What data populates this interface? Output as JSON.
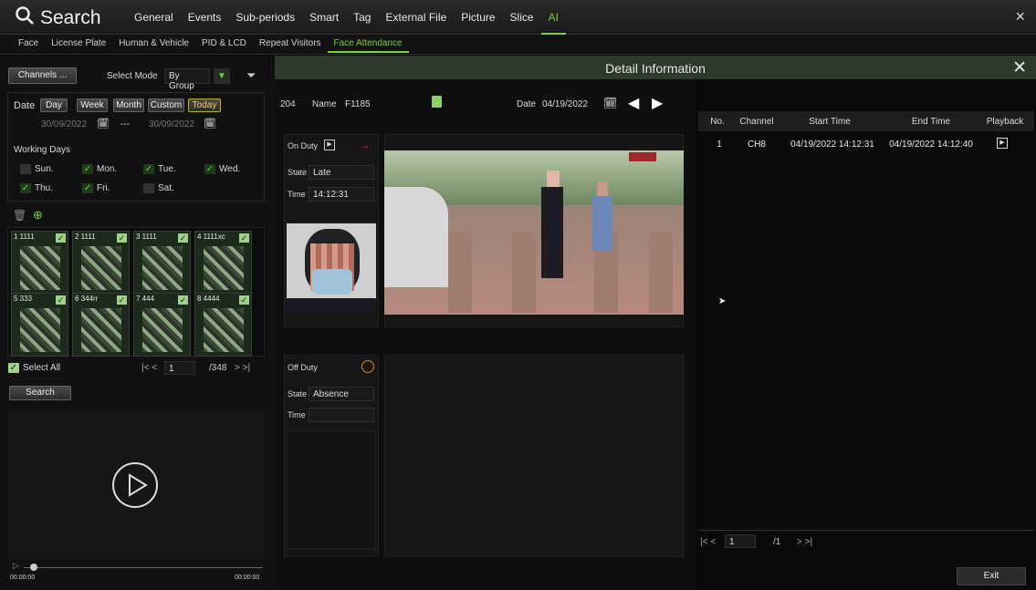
{
  "header": {
    "title": "Search",
    "tabs": [
      "General",
      "Events",
      "Sub-periods",
      "Smart",
      "Tag",
      "External File",
      "Picture",
      "Slice",
      "AI"
    ],
    "active_tab": "AI",
    "close": "×"
  },
  "subtabs": {
    "items": [
      "Face",
      "License Plate",
      "Human & Vehicle",
      "PID & LCD",
      "Repeat Visitors",
      "Face Attendance"
    ],
    "active": "Face Attendance"
  },
  "left": {
    "channels_button": "Channels ...",
    "select_mode_label": "Select Mode",
    "select_mode_value": "By Group",
    "date_label": "Date",
    "date_buttons": [
      "Day",
      "Week",
      "Month",
      "Custom",
      "Today"
    ],
    "date_from": "30/09/2022",
    "date_sep": "---",
    "date_to": "30/09/2022",
    "working_days_label": "Working Days",
    "days": [
      {
        "label": "Sun.",
        "checked": false
      },
      {
        "label": "Mon.",
        "checked": true
      },
      {
        "label": "Tue.",
        "checked": true
      },
      {
        "label": "Wed.",
        "checked": true
      },
      {
        "label": "Thu.",
        "checked": true
      },
      {
        "label": "Fri.",
        "checked": true
      },
      {
        "label": "Sat.",
        "checked": false
      }
    ],
    "faces": [
      "1 1111",
      "2 1111",
      "3 1111",
      "4 1111xc",
      "5 333",
      "6 344rr",
      "7 444",
      "8 4444"
    ],
    "select_all": "Select All",
    "page_current": "1",
    "page_total": "/348",
    "search_button": "Search",
    "time_start": "00:00:00",
    "time_end": "00:00:00"
  },
  "detail": {
    "title": "Detail Information",
    "id": "204",
    "name_label": "Name",
    "name_value": "F1185",
    "date_label": "Date",
    "date_value": "04/19/2022",
    "on_duty": {
      "label": "On Duty",
      "state_label": "State",
      "state_value": "Late",
      "time_label": "Time",
      "time_value": "14:12:31"
    },
    "off_duty": {
      "label": "Off Duty",
      "state_label": "State",
      "state_value": "Absence",
      "time_label": "Time",
      "time_value": ""
    }
  },
  "table": {
    "headers": [
      "No.",
      "Channel",
      "Start Time",
      "End Time",
      "Playback"
    ],
    "rows": [
      {
        "no": "1",
        "channel": "CH8",
        "start": "04/19/2022 14:12:31",
        "end": "04/19/2022 14:12:40"
      }
    ],
    "page_current": "1",
    "page_total": "/1",
    "exit_button": "Exit"
  },
  "colors": {
    "accent": "#7ccf3c",
    "panel": "#111111",
    "header": "#2d3a2b",
    "late_arrow": "#e03030",
    "off_duty_circle": "#d08a20"
  }
}
